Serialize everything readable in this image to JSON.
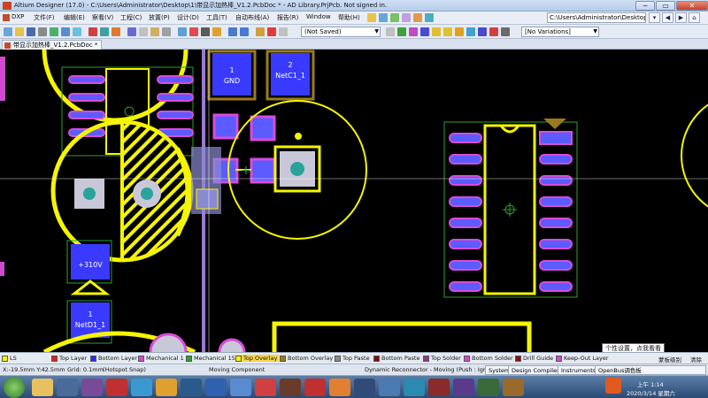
{
  "window": {
    "title": "Altium Designer (17.0) - C:\\Users\\Administrator\\Desktop\\1\\带显示加热棒_V1.2.PcbDoc * - AD Library.PrjPcb. Not signed in.",
    "minimize": "─",
    "maximize": "▭",
    "close": "✕"
  },
  "menu": {
    "items": [
      "DXP",
      "文件(F)",
      "编辑(E)",
      "察看(V)",
      "工程(C)",
      "放置(P)",
      "设计(D)",
      "工具(T)",
      "自动布线(A)",
      "报告(R)",
      "Window",
      "帮助(H)"
    ],
    "path": "C:\\Users\\Administrator\\Desktop\\"
  },
  "toolbar": {
    "save_state": "(Not Saved)",
    "variations": "[No Variations]"
  },
  "document_tab": {
    "label": "带显示加热棒_V1.2.PcbDoc *"
  },
  "pcb": {
    "labels": {
      "pad_gnd_num": "1",
      "pad_gnd_net": "GND",
      "pad_netc1_num": "2",
      "pad_netc1_net": "NetC1_1",
      "pad_310v": "+310V",
      "pad_netd1_num": "1",
      "pad_netd1_net": "NetD1_1"
    },
    "colors": {
      "overlay": "#f5f500",
      "pad": "#5b5bff",
      "solder": "#d94bd9",
      "mech": "#2f9e2f",
      "hole": "#2aa39a",
      "background": "#000000"
    }
  },
  "layers": [
    {
      "label": "LS",
      "color": "#f5f500"
    },
    {
      "label": "Top Layer",
      "color": "#e02020"
    },
    {
      "label": "Bottom Layer",
      "color": "#2a2aff"
    },
    {
      "label": "Mechanical 1",
      "color": "#d04ad0"
    },
    {
      "label": "Mechanical 15",
      "color": "#2f9e2f"
    },
    {
      "label": "Top Overlay",
      "color": "#f5f500"
    },
    {
      "label": "Bottom Overlay",
      "color": "#9a7a20"
    },
    {
      "label": "Top Paste",
      "color": "#8a8a8a"
    },
    {
      "label": "Bottom Paste",
      "color": "#7a1010"
    },
    {
      "label": "Top Solder",
      "color": "#8a3a8a"
    },
    {
      "label": "Bottom Solder",
      "color": "#d04ad0"
    },
    {
      "label": "Drill Guide",
      "color": "#8a1010"
    },
    {
      "label": "Keep-Out Layer",
      "color": "#d04ad0"
    }
  ],
  "layerbar_extra": {
    "mask": "蒙板级别",
    "clear": "清除"
  },
  "status": {
    "coords": "X:-19.5mm Y:42.5mm",
    "grid": "Grid: 0.1mm",
    "snap": "(Hotspot Snap)",
    "action": "Moving Component",
    "reconnector": "Dynamic Reconnector - Moving (Push : Ignor",
    "panels": [
      "System",
      "Design Compiler",
      "Instruments",
      "OpenBus调色板"
    ]
  },
  "tooltip": {
    "text": "个性设置，点我看看"
  },
  "taskbar": {
    "time": "上午 1:14",
    "date": "2020/3/14 星期六"
  }
}
